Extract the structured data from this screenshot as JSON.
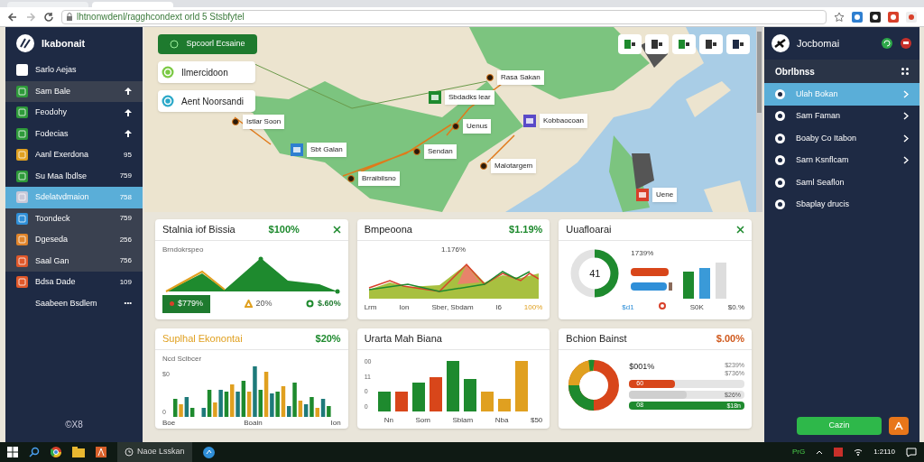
{
  "browser": {
    "address": "lhtnonwdenl/ragghcondext orld 5 Stsbfytel"
  },
  "sidebar": {
    "title": "Ikabonait",
    "items": [
      {
        "label": "Sarlo Aejas",
        "color": "#ffffff",
        "selected": false,
        "shaded": false,
        "pinned": false
      },
      {
        "label": "Sam Bale",
        "color": "#2e9a3a",
        "selected": false,
        "shaded": true,
        "pinned": true
      },
      {
        "label": "Feodohy",
        "color": "#2e9a3a",
        "selected": false,
        "shaded": false,
        "pinned": true
      },
      {
        "label": "Fodecias",
        "color": "#2e9a3a",
        "selected": false,
        "shaded": false,
        "pinned": true
      },
      {
        "label": "Aanl Exerdona",
        "count": "95",
        "color": "#e0a020",
        "selected": false,
        "shaded": false,
        "pinned": false
      },
      {
        "label": "Su Maa lbdlse",
        "count": "759",
        "color": "#2e9a3a",
        "selected": false,
        "shaded": false,
        "pinned": false
      },
      {
        "label": "Sdelatvdmaion",
        "count": "758",
        "color": "#c8c8d8",
        "selected": true,
        "pinned": false
      },
      {
        "label": "Toondeck",
        "count": "759",
        "color": "#2f8fd8",
        "selected": false,
        "shaded": true,
        "pinned": false
      },
      {
        "label": "Dgeseda",
        "count": "256",
        "color": "#e0842a",
        "selected": false,
        "shaded": true,
        "pinned": false
      },
      {
        "label": "Saal Gan",
        "count": "756",
        "color": "#e0582a",
        "selected": false,
        "shaded": true,
        "pinned": false
      },
      {
        "label": "Bdsa Dade",
        "count": "109",
        "color": "#e0582a",
        "selected": false,
        "shaded": false,
        "pinned": false
      },
      {
        "label": "Saabeen Bsdlem",
        "count": "•••",
        "selected": false,
        "shaded": false,
        "pinned": false
      }
    ],
    "footer": "©X8"
  },
  "map": {
    "layers": [
      {
        "kind": "button",
        "label": "Spcoorl Ecsaine"
      },
      {
        "kind": "card",
        "label": "Ilmercidoon",
        "color": "#7ac943"
      },
      {
        "kind": "card",
        "label": "Aent Noorsandi",
        "color": "#2aa8c8"
      }
    ],
    "markers": [
      {
        "kind": "dot",
        "label": "Istlar Soon"
      },
      {
        "kind": "icon",
        "label": "Sbt Galan",
        "color": "#2f7fd0"
      },
      {
        "kind": "dot",
        "label": "Brraibilsno"
      },
      {
        "kind": "dot",
        "label": "Sendan"
      },
      {
        "kind": "dot",
        "label": "Uenus"
      },
      {
        "kind": "icon",
        "label": "Sbdadks lear",
        "color": "#1e8a2e"
      },
      {
        "kind": "dot",
        "label": "Rasa Sakan"
      },
      {
        "kind": "icon",
        "label": "Kobbaocoan",
        "color": "#5a4ac8"
      },
      {
        "kind": "dot",
        "label": "Malotargem"
      },
      {
        "kind": "icon",
        "label": "Uene",
        "color": "#d8402a"
      }
    ]
  },
  "cards": [
    {
      "kind": "area",
      "title": "Stalnia iof Bissia",
      "accent_title": false,
      "closable": true,
      "subtitle": "Brndokrspeo",
      "value": "$100%",
      "negative": false,
      "stats": [
        {
          "kind": "badge",
          "text": "$779%"
        },
        {
          "kind": "triangle",
          "text": "20%"
        },
        {
          "kind": "ring",
          "text": "$.60%"
        }
      ]
    },
    {
      "kind": "line",
      "title": "Bmpeoona",
      "accent_title": false,
      "closable": false,
      "value": "$1.19%",
      "negative": false,
      "peak": "1.176%",
      "labels": [
        {
          "text": "Lrm",
          "accent": false
        },
        {
          "text": "Ion",
          "accent": false
        },
        {
          "text": "Sber, Sbdam",
          "accent": false
        },
        {
          "text": "l6",
          "accent": false
        },
        {
          "text": "100%",
          "accent": true
        }
      ]
    },
    {
      "kind": "gauge",
      "title": "Uuafloarai",
      "accent_title": false,
      "closable": true,
      "center": "41",
      "caption": "1739%",
      "labels": [
        {
          "text": "$d1",
          "accent": true
        },
        {
          "text": "S0K",
          "accent": false
        },
        {
          "text": "$0.%",
          "accent": false
        }
      ]
    },
    {
      "kind": "bars",
      "title": "Suplhal Ekonontai",
      "accent_title": true,
      "closable": false,
      "value": "$20%",
      "negative": false,
      "subtitle": "Ncd Sclbcer",
      "yticks": [
        "$0",
        "0"
      ],
      "labels": [
        {
          "text": "Boe"
        },
        {
          "text": "Boain"
        },
        {
          "text": "Ion"
        }
      ]
    },
    {
      "kind": "columns",
      "title": "Urarta Mah Biana",
      "accent_title": false,
      "closable": false,
      "yticks": [
        "00",
        "11",
        "0",
        "0"
      ],
      "labels": [
        {
          "text": "Nn"
        },
        {
          "text": "Som"
        },
        {
          "text": "Sblam"
        },
        {
          "text": "Nba"
        },
        {
          "text": "$50"
        }
      ]
    },
    {
      "kind": "donut",
      "title": "Bchion Bainst",
      "accent_title": false,
      "closable": false,
      "value": "$.00%",
      "negative": true,
      "legend": "$001%",
      "notes": [
        "$239%",
        "$736%"
      ],
      "meters": [
        {
          "level": 0.4,
          "color": "#d8461a",
          "text": "60"
        },
        {
          "level": 0.5,
          "color": "#cfcfcf",
          "reading": "$26%"
        },
        {
          "level": 1,
          "color": "#1e8a2e",
          "text": "08",
          "reading": "$18n"
        }
      ]
    }
  ],
  "panel": {
    "title": "Jocbomai",
    "section": "Obrlbnss",
    "items": [
      {
        "label": "Ulah Bokan",
        "selected": true,
        "chevron": true
      },
      {
        "label": "Sam Faman",
        "selected": false,
        "chevron": true
      },
      {
        "label": "Boaby Co Itabon",
        "selected": false,
        "chevron": true
      },
      {
        "label": "Sarn Ksnflcam",
        "selected": false,
        "chevron": true
      },
      {
        "label": "Saml Seaflon",
        "selected": false,
        "chevron": false
      },
      {
        "label": "Sbaplay drucis",
        "selected": false,
        "chevron": false
      }
    ],
    "button": "Cazin"
  },
  "taskbar": {
    "app": "Naoe Lsskan",
    "tray": "PrG",
    "time": "1:2110"
  }
}
